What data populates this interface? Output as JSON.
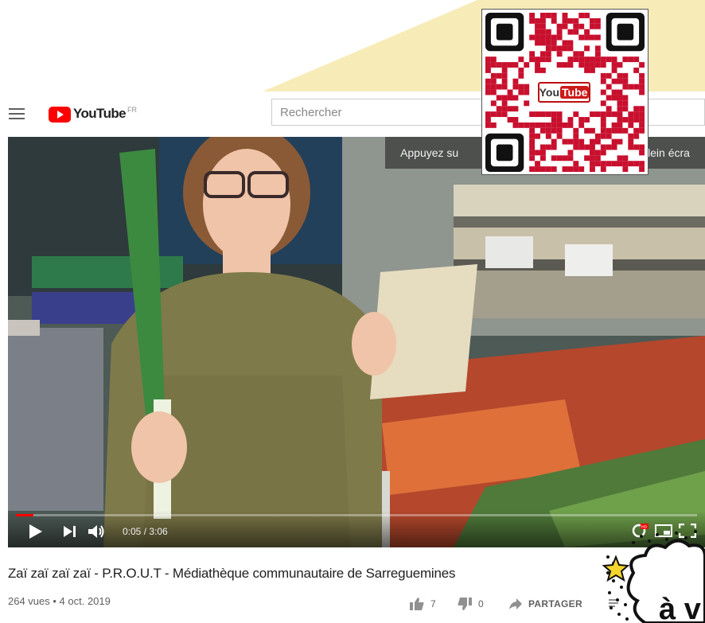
{
  "header": {
    "logo_text": "YouTube",
    "country": "FR",
    "search_placeholder": "Rechercher"
  },
  "player": {
    "fullscreen_hint_left": "Appuyez su",
    "fullscreen_hint_right": "plein écra",
    "time": "0:05 / 3:06",
    "progress": 0.026
  },
  "qr_code": {
    "logo_you": "You",
    "logo_tube": "Tube"
  },
  "video": {
    "title": "Zaï zaï zaï zaï - P.R.O.U.T - Médiathèque communautaire de Sarreguemines",
    "meta": "264 vues • 4 oct. 2019",
    "likes": "7",
    "dislikes": "0",
    "share_label": "PARTAGER"
  },
  "sticker": {
    "text": "à v"
  },
  "colors": {
    "brand_red": "#ff0000",
    "qr_red": "#c8102e",
    "paper_yellow": "#f7ecb8"
  },
  "icons": [
    "menu-icon",
    "youtube-logo-icon",
    "play-icon",
    "next-icon",
    "volume-icon",
    "hd-icon",
    "miniplayer-icon",
    "fullscreen-icon",
    "thumbs-up-icon",
    "thumbs-down-icon",
    "share-icon",
    "more-icon",
    "star-icon"
  ]
}
